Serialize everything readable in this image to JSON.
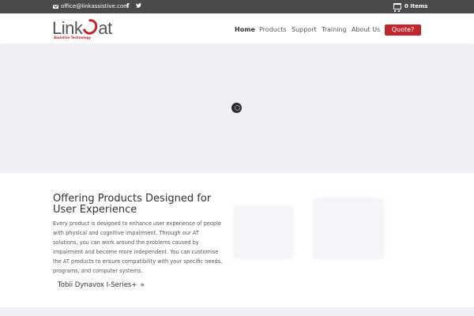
{
  "topbar": {
    "email": "office@linkassistive.com",
    "facebook_glyph": "f",
    "twitter_glyph": "🐦",
    "cart_label": "0 Items",
    "icons": [
      "envelope-icon",
      "facebook-icon",
      "twitter-icon",
      "cart-icon"
    ]
  },
  "header": {
    "logo_text": "Link",
    "logo_suffix": "at",
    "logo_tagline": "Assistive Technology",
    "nav": [
      "Home",
      "Products",
      "Support",
      "Training",
      "About Us"
    ],
    "quote_label": "Quote?"
  },
  "main": {
    "heading": "Offering Products Designed for User Experience",
    "paragraph": "Every product is designed to enhance user experience of people with physical and cognitive impairment. Through our AT solutions, you can work around the problems caused by impairment and become more independent. You can customise the AT products to ensure compatibility with your specific needs, programs, and computer systems.",
    "product_link": "Tobii Dynavox I-Series+",
    "product_link_arrow": "»"
  },
  "colors": {
    "brand_red": "#c0262e",
    "topbar_bg": "#4a4a4a",
    "hero_bg": "#eef0f6"
  }
}
